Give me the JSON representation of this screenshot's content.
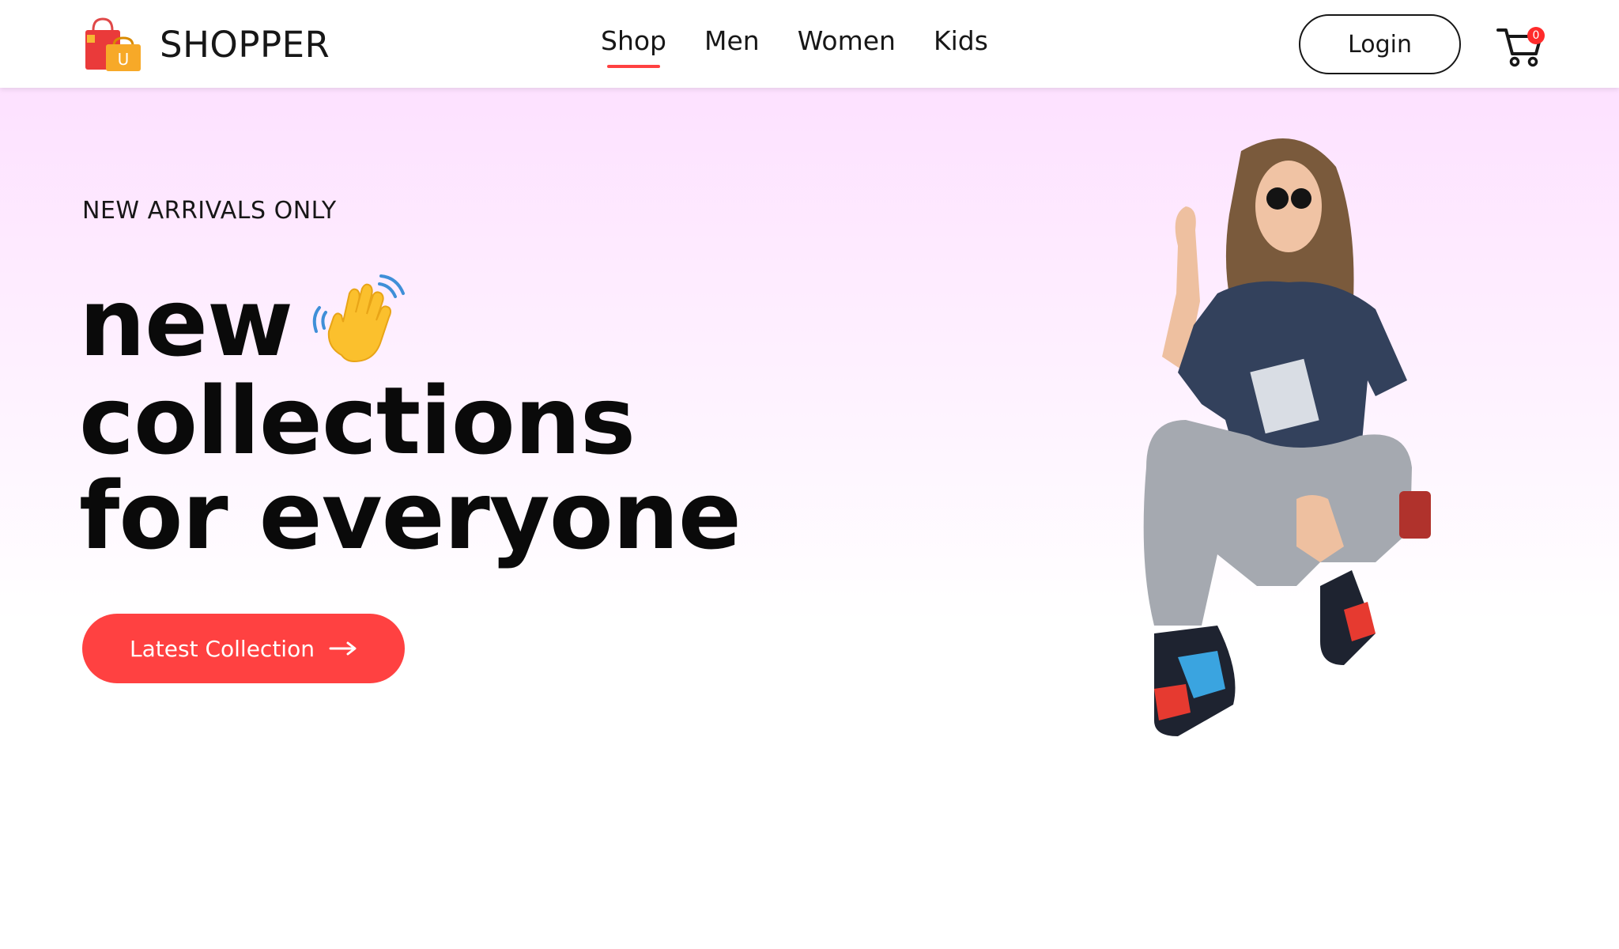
{
  "brand": {
    "name": "SHOPPER",
    "logo_letter": "U"
  },
  "nav": {
    "items": [
      {
        "label": "Shop",
        "active": true
      },
      {
        "label": "Men",
        "active": false
      },
      {
        "label": "Women",
        "active": false
      },
      {
        "label": "Kids",
        "active": false
      }
    ]
  },
  "header": {
    "login_label": "Login",
    "cart_count": "0"
  },
  "hero": {
    "tagline": "NEW ARRIVALS ONLY",
    "headline": [
      "new",
      "collections",
      "for everyone"
    ],
    "cta_label": "Latest Collection"
  },
  "colors": {
    "accent": "#ff4141",
    "hero_gradient_top": "#fde1ff",
    "text": "#171717"
  },
  "icons": {
    "logo": "shopping-bag-icon",
    "cart": "cart-icon",
    "wave": "waving-hand-icon",
    "arrow": "arrow-right-icon"
  }
}
